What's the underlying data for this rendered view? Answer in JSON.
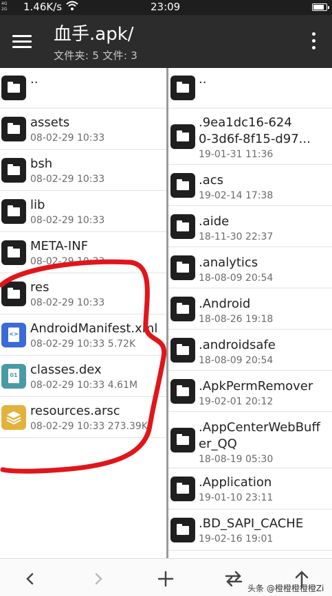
{
  "status_bar": {
    "network_top": "4G",
    "network_bottom": "2G",
    "speed": "1.46K/s",
    "time": "23:09",
    "battery_level": 0.75
  },
  "app_bar": {
    "title": "血手.apk/",
    "subtitle": "文件夹: 5  文件: 3"
  },
  "left_pane": {
    "items": [
      {
        "name": "..",
        "meta": "",
        "icon": "folder-icon"
      },
      {
        "name": "assets",
        "meta": "08-02-29 10:33",
        "icon": "folder-icon"
      },
      {
        "name": "bsh",
        "meta": "08-02-29 10:33",
        "icon": "folder-icon"
      },
      {
        "name": "lib",
        "meta": "08-02-29 10:33",
        "icon": "folder-icon"
      },
      {
        "name": "META-INF",
        "meta": "08-02-29 10:33",
        "icon": "folder-icon"
      },
      {
        "name": "res",
        "meta": "08-02-29 10:33",
        "icon": "folder-icon"
      },
      {
        "name": "AndroidManifest.xml",
        "meta": "08-02-29 10:33  5.72K",
        "icon": "xml-file-icon"
      },
      {
        "name": "classes.dex",
        "meta": "08-02-29 10:33  4.61M",
        "icon": "dex-file-icon",
        "icon_text": "01"
      },
      {
        "name": "resources.arsc",
        "meta": "08-02-29 10:33  273.39K",
        "icon": "layers-icon"
      }
    ]
  },
  "right_pane": {
    "items": [
      {
        "name": "..",
        "meta": ""
      },
      {
        "name": ".9ea1dc16-624",
        "name2": "0-3d6f-8f15-d97...",
        "meta": "19-01-31 11:36"
      },
      {
        "name": ".acs",
        "meta": "19-02-14 17:38"
      },
      {
        "name": ".aide",
        "meta": "18-11-30 22:37"
      },
      {
        "name": ".analytics",
        "meta": "18-08-09 20:54"
      },
      {
        "name": ".Android",
        "meta": "18-08-26 19:18"
      },
      {
        "name": ".androidsafe",
        "meta": "18-08-09 20:54"
      },
      {
        "name": ".ApkPermRemover",
        "meta": "19-02-01 20:12"
      },
      {
        "name": ".AppCenterWebBuff",
        "name2": "er_QQ",
        "meta": "18-08-19 05:30"
      },
      {
        "name": ".Application",
        "meta": "19-01-10 23:11"
      },
      {
        "name": ".BD_SAPI_CACHE",
        "meta": "19-02-16 19:01"
      }
    ]
  },
  "bottom_bar": {
    "buttons": [
      "back-icon",
      "forward-icon",
      "add-icon",
      "swap-icon",
      "up-icon"
    ]
  },
  "watermark": "头条 @橙橙橙橙橙Zi",
  "colors": {
    "app_bar": "#2c2c2c",
    "annotation": "#e0161a",
    "xml_icon": "#3c6ad6",
    "dex_icon": "#4a9aa6",
    "arsc_icon": "#e3b23c"
  }
}
